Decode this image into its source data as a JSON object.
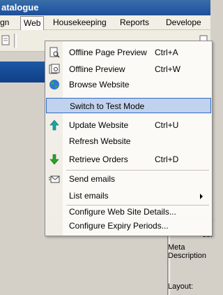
{
  "window": {
    "title": "atalogue"
  },
  "menubar": {
    "items": [
      "gn",
      "Web",
      "Housekeeping",
      "Reports",
      "Develope"
    ]
  },
  "background": {
    "header_fragment": "Ho",
    "side_labels": [
      "e:",
      "e:",
      "e:",
      "ds:"
    ],
    "meta_label": "Meta Description",
    "layout_label": "Layout:"
  },
  "web_menu": {
    "items": [
      {
        "label": "Offline Page Preview",
        "shortcut": "Ctrl+A",
        "icon": "page-preview-icon"
      },
      {
        "label": "Offline Preview",
        "shortcut": "Ctrl+W",
        "icon": "preview-icon"
      },
      {
        "label": "Browse Website",
        "shortcut": "",
        "icon": "globe-icon"
      },
      {
        "label": "Switch to Test Mode",
        "shortcut": "",
        "icon": ""
      },
      {
        "label": "Update Website",
        "shortcut": "Ctrl+U",
        "icon": "upload-arrow-icon"
      },
      {
        "label": "Refresh Website",
        "shortcut": "",
        "icon": ""
      },
      {
        "label": "Retrieve Orders",
        "shortcut": "Ctrl+D",
        "icon": "download-arrow-icon"
      },
      {
        "label": "Send emails",
        "shortcut": "",
        "icon": "email-icon"
      },
      {
        "label": "List emails",
        "shortcut": "",
        "icon": ""
      },
      {
        "label": "Configure Web Site Details...",
        "shortcut": "",
        "icon": ""
      },
      {
        "label": "Configure Expiry Periods...",
        "shortcut": "",
        "icon": ""
      }
    ],
    "highlighted": "Switch to Test Mode"
  },
  "colors": {
    "highlight_bg": "#c1d2ee",
    "highlight_border": "#316ac5",
    "title_bar": "#2b5fa8"
  }
}
